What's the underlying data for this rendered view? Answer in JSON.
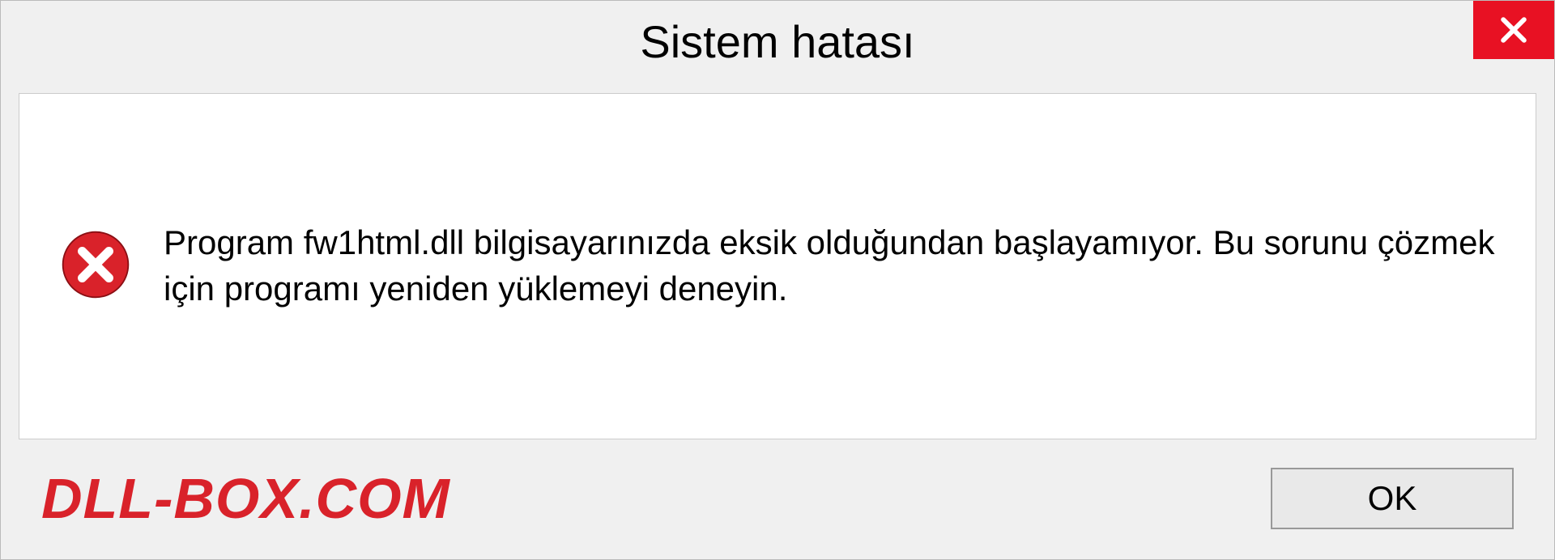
{
  "dialog": {
    "title": "Sistem hatası",
    "message": "Program fw1html.dll bilgisayarınızda eksik olduğundan başlayamıyor. Bu sorunu çözmek için programı yeniden yüklemeyi deneyin.",
    "ok_label": "OK"
  },
  "watermark": "DLL-BOX.COM",
  "colors": {
    "close_bg": "#e81123",
    "watermark": "#d9222a"
  },
  "icons": {
    "close": "close-icon",
    "error": "error-circle-icon"
  }
}
